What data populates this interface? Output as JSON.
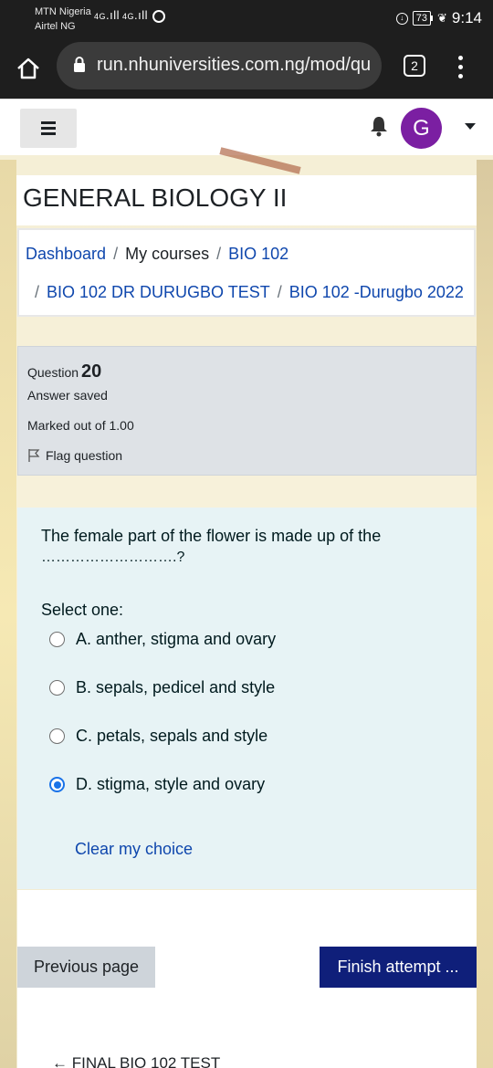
{
  "status_bar": {
    "carrier1": "MTN Nigeria",
    "carrier2": "Airtel NG",
    "signal1": "4G",
    "signal2": "4G",
    "battery": "73",
    "time": "9:14"
  },
  "browser": {
    "url": "run.nhuniversities.com.ng/mod/qu",
    "tab_count": "2"
  },
  "header": {
    "avatar_letter": "G"
  },
  "page": {
    "title": "GENERAL BIOLOGY II"
  },
  "breadcrumb": {
    "items": [
      {
        "label": "Dashboard"
      },
      {
        "label": "My courses"
      },
      {
        "label": "BIO 102"
      },
      {
        "label": "BIO 102 DR DURUGBO TEST"
      },
      {
        "label": "BIO 102 -Durugbo 2022"
      }
    ],
    "separator": "/"
  },
  "question": {
    "number_label": "Question",
    "number": "20",
    "state": "Answer saved",
    "grade": "Marked out of 1.00",
    "flag_label": "Flag question",
    "text": "The female part of the flower is made up of the",
    "blank": "……………………….?",
    "select_prompt": "Select one:",
    "options": [
      {
        "label": "A. anther, stigma and ovary",
        "checked": false
      },
      {
        "label": "B. sepals, pedicel and style",
        "checked": false
      },
      {
        "label": "C. petals, sepals and style",
        "checked": false
      },
      {
        "label": "D. stigma, style and ovary",
        "checked": true
      }
    ],
    "clear_label": "Clear my choice"
  },
  "nav": {
    "prev_label": "Previous page",
    "finish_label": "Finish attempt ...",
    "next_activity": "← FINAL BIO 102 TEST"
  },
  "colors": {
    "link": "#0f47ad",
    "finish_button": "#0f1f7a",
    "avatar_bg": "#7b1fa2",
    "radio_checked": "#1a73e8",
    "question_bg": "#e7f3f5"
  }
}
